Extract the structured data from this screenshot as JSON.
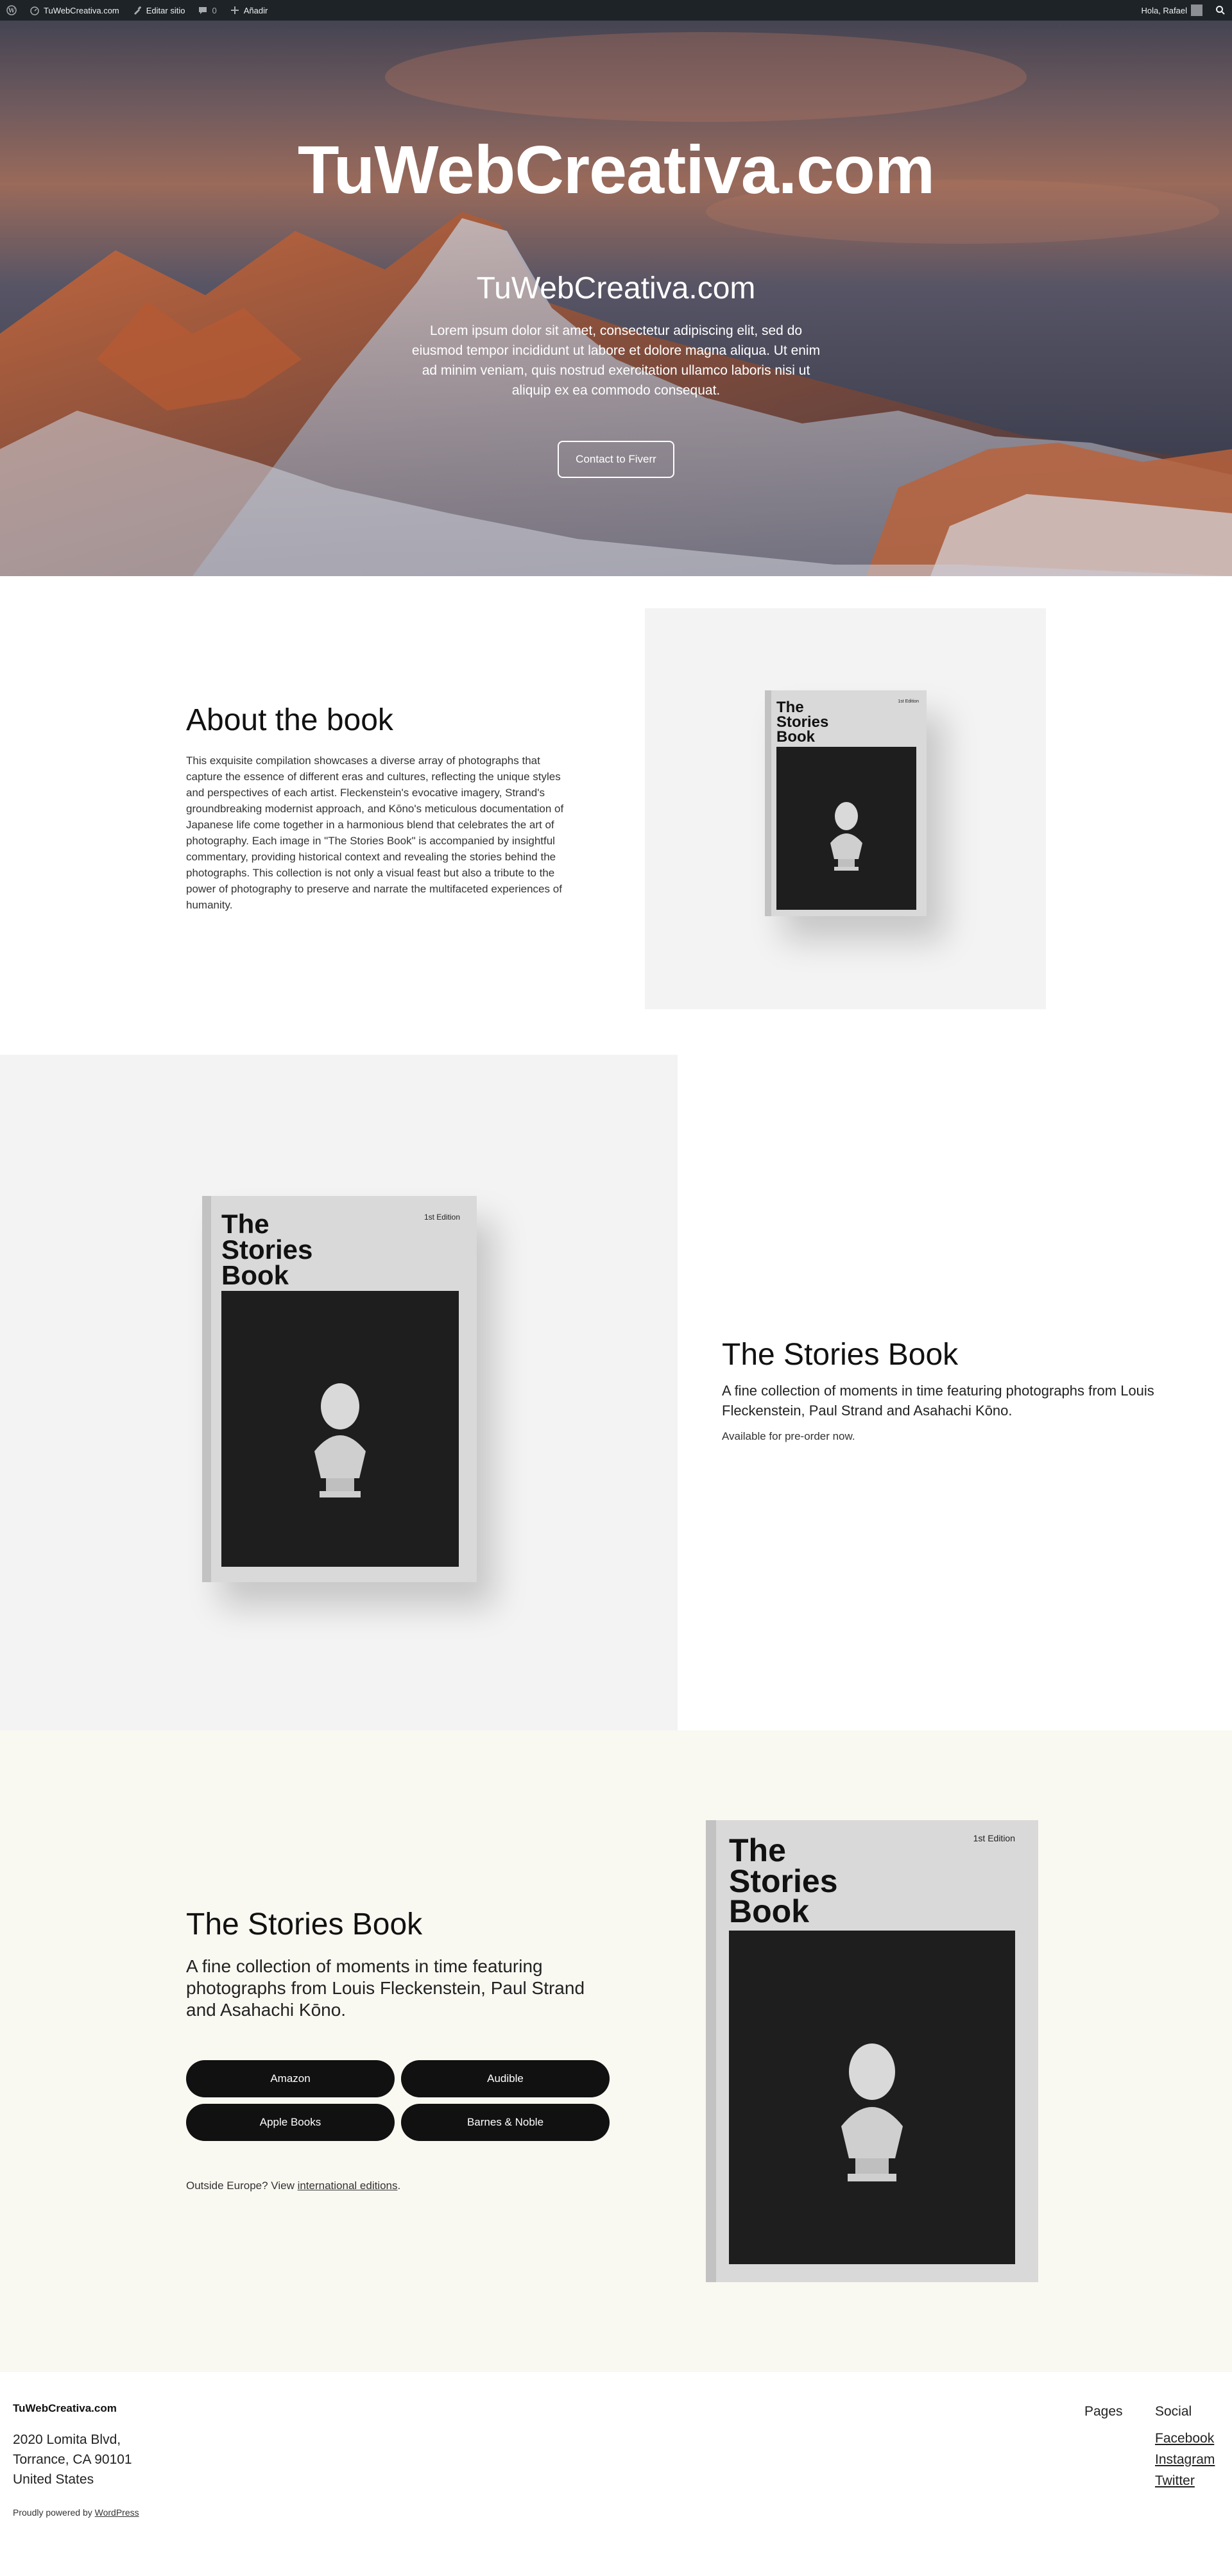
{
  "adminbar": {
    "site_name": "TuWebCreativa.com",
    "edit_site": "Editar sitio",
    "comments_count": "0",
    "add_new": "Añadir",
    "greeting": "Hola, Rafael"
  },
  "hero": {
    "title": "TuWebCreativa.com",
    "subtitle": "TuWebCreativa.com",
    "text": "Lorem ipsum dolor sit amet, consectetur adipiscing elit, sed do eiusmod tempor incididunt ut labore et dolore magna aliqua. Ut enim ad minim veniam, quis nostrud exercitation ullamco laboris nisi ut aliquip ex ea commodo consequat.",
    "button": "Contact to Fiverr"
  },
  "about": {
    "title": "About the book",
    "text": "This exquisite compilation showcases a diverse array of photographs that capture the essence of different eras and cultures, reflecting the unique styles and perspectives of each artist. Fleckenstein's evocative imagery, Strand's groundbreaking modernist approach, and Kōno's meticulous documentation of Japanese life come together in a harmonious blend that celebrates the art of photography. Each image in \"The Stories Book\" is accompanied by insightful commentary, providing historical context and revealing the stories behind the photographs. This collection is not only a visual feast but also a tribute to the power of photography to preserve and narrate the multifaceted experiences of humanity."
  },
  "book_cover": {
    "title": "The\nStories\nBook",
    "edition": "1st Edition"
  },
  "stories": {
    "title": "The Stories Book",
    "description": "A fine collection of moments in time featuring photographs from Louis Fleckenstein, Paul Strand and Asahachi Kōno.",
    "availability": "Available for pre-order now."
  },
  "buy": {
    "title": "The Stories Book",
    "description": "A fine collection of moments in time featuring photographs from Louis Fleckenstein, Paul Strand and Asahachi Kōno.",
    "buttons": [
      "Amazon",
      "Audible",
      "Apple Books",
      "Barnes & Noble"
    ],
    "note_prefix": "Outside Europe? View ",
    "note_link": "international editions",
    "note_suffix": "."
  },
  "footer": {
    "site_name": "TuWebCreativa.com",
    "address_line1": "2020 Lomita Blvd,",
    "address_line2": "Torrance, CA 90101",
    "address_line3": "United States",
    "powered_prefix": "Proudly powered by ",
    "powered_link": "WordPress",
    "pages_heading": "Pages",
    "social_heading": "Social",
    "social_links": [
      "Facebook",
      "Instagram",
      "Twitter"
    ]
  }
}
